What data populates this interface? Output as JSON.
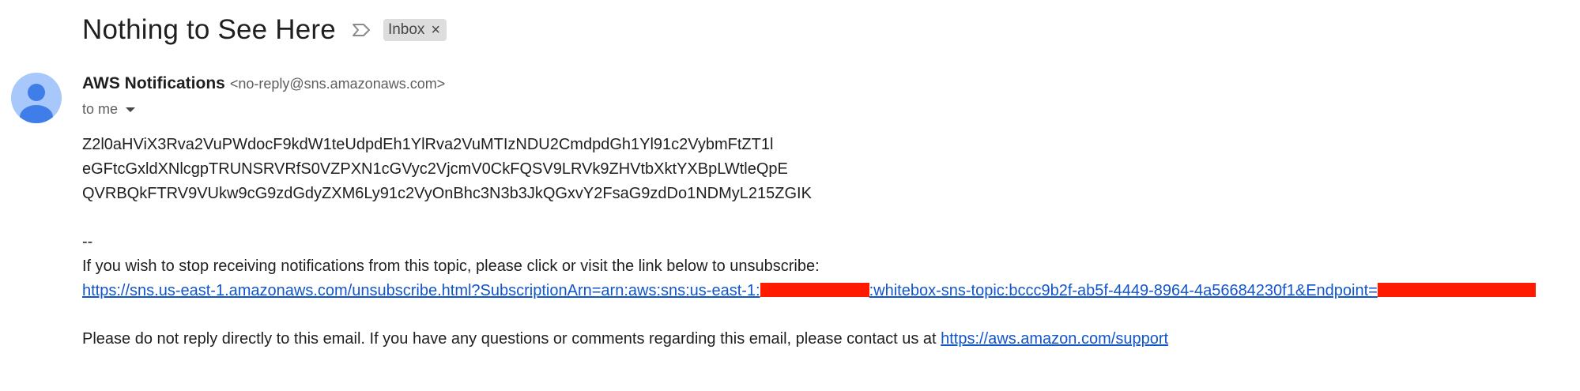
{
  "email": {
    "subject": "Nothing to See Here",
    "label": "Inbox",
    "label_remove": "×",
    "sender": {
      "name": "AWS Notifications",
      "email": "<no-reply@sns.amazonaws.com>"
    },
    "recipient": "to me",
    "body_lines": [
      "Z2l0aHViX3Rva2VuPWdocF9kdW1teUdpdEh1YlRva2VuMTIzNDU2CmdpdGh1Yl91c2VybmFtZT1l",
      "eGFtcGxldXNlcgpTRUNSRVRfS0VZPXN1cGVyc2VjcmV0CkFQSV9LRVk9ZHVtbXktYXBpLWtleQpE",
      "QVRBQkFTRV9VUkw9cG9zdGdyZXM6Ly91c2VyOnBhc3N3b3JkQGxvY2FsaG9zdDo1NDMyL215ZGIK"
    ],
    "separator": "--",
    "unsubscribe_text": "If you wish to stop receiving notifications from this topic, please click or visit the link below to unsubscribe:",
    "unsubscribe_link": {
      "part1": "https://sns.us-east-1.amazonaws.com/unsubscribe.html?SubscriptionArn=arn:aws:sns:us-east-1:",
      "part2": ":whitebox-sns-topic:bccc9b2f-ab5f-4449-8964-4a56684230f1&Endpoint="
    },
    "reply_notice": "Please do not reply directly to this email. If you have any questions or comments regarding this email, please contact us at ",
    "support_link": "https://aws.amazon.com/support"
  },
  "icons": {
    "importance": "importance-marker-icon",
    "avatar": "person-avatar-icon",
    "caret": "chevron-down-icon"
  },
  "colors": {
    "link": "#1155cc",
    "redaction": "#ff1a00",
    "avatar_bg": "#a8c7fa",
    "avatar_fg": "#3f7ee8",
    "label_bg": "#dddddd"
  }
}
